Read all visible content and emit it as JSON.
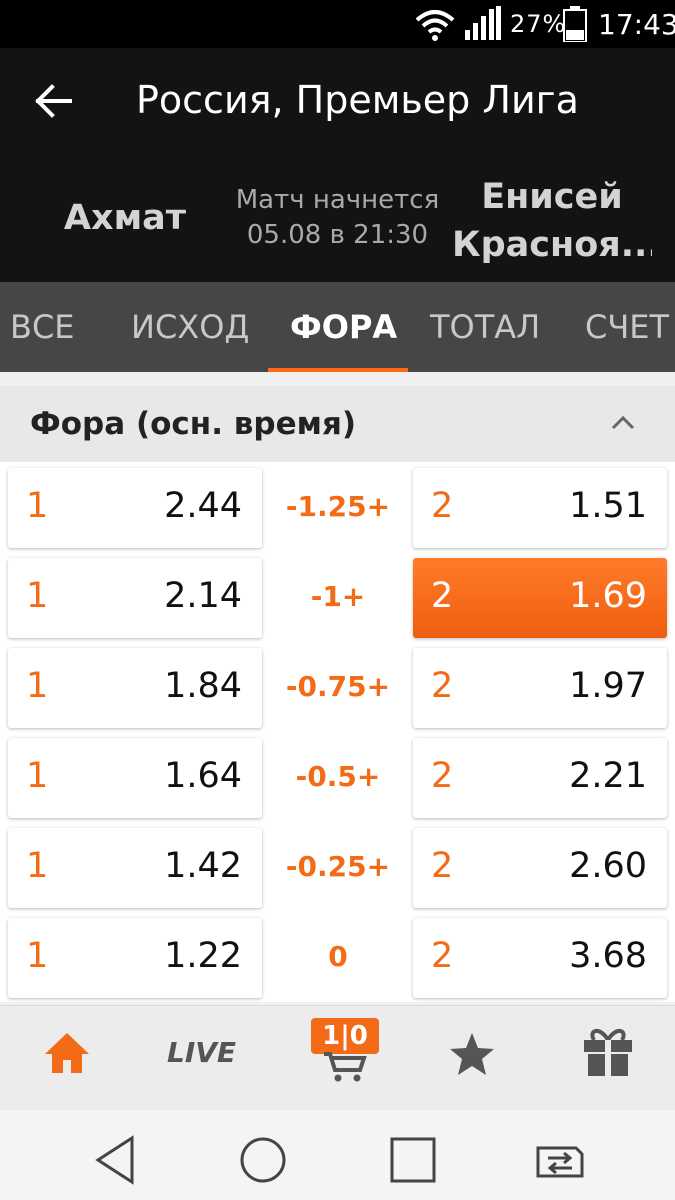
{
  "status_bar": {
    "battery_percent": "27%",
    "time": "17:43"
  },
  "header": {
    "title": "Россия, Премьер Лига",
    "home_team": "Ахмат",
    "match_info_line1": "Матч начнется",
    "match_info_line2": "05.08 в 21:30",
    "away_team_line1": "Енисей",
    "away_team_line2": "Красноя..."
  },
  "tabs": [
    {
      "label": "ВСЕ"
    },
    {
      "label": "ИСХОД"
    },
    {
      "label": "ФОРА"
    },
    {
      "label": "ТОТАЛ"
    },
    {
      "label": "СЧЕТ"
    }
  ],
  "active_tab": "ФОРА",
  "section": {
    "title": "Фора (осн. время)"
  },
  "rows": [
    {
      "left_label": "1",
      "left_odds": "2.44",
      "handicap": "-1.25+",
      "right_label": "2",
      "right_odds": "1.51"
    },
    {
      "left_label": "1",
      "left_odds": "2.14",
      "handicap": "-1+",
      "right_label": "2",
      "right_odds": "1.69"
    },
    {
      "left_label": "1",
      "left_odds": "1.84",
      "handicap": "-0.75+",
      "right_label": "2",
      "right_odds": "1.97"
    },
    {
      "left_label": "1",
      "left_odds": "1.64",
      "handicap": "-0.5+",
      "right_label": "2",
      "right_odds": "2.21"
    },
    {
      "left_label": "1",
      "left_odds": "1.42",
      "handicap": "-0.25+",
      "right_label": "2",
      "right_odds": "2.60"
    },
    {
      "left_label": "1",
      "left_odds": "1.22",
      "handicap": "0",
      "right_label": "2",
      "right_odds": "3.68"
    }
  ],
  "selected_cell": "row-2-right",
  "bottom_nav": {
    "items": [
      "home-icon",
      "live",
      "coupon-cart-icon",
      "star-icon",
      "gift-icon"
    ],
    "live_label": "LIVE",
    "coupon_badge": "1|0"
  },
  "system_nav": {
    "items": [
      "back-triangle-icon",
      "home-circle-icon",
      "recents-square-icon",
      "switch-sim-icon"
    ]
  },
  "colors": {
    "accent": "#f36b17",
    "header_bg": "#131313",
    "tabs_bg": "#464646"
  }
}
